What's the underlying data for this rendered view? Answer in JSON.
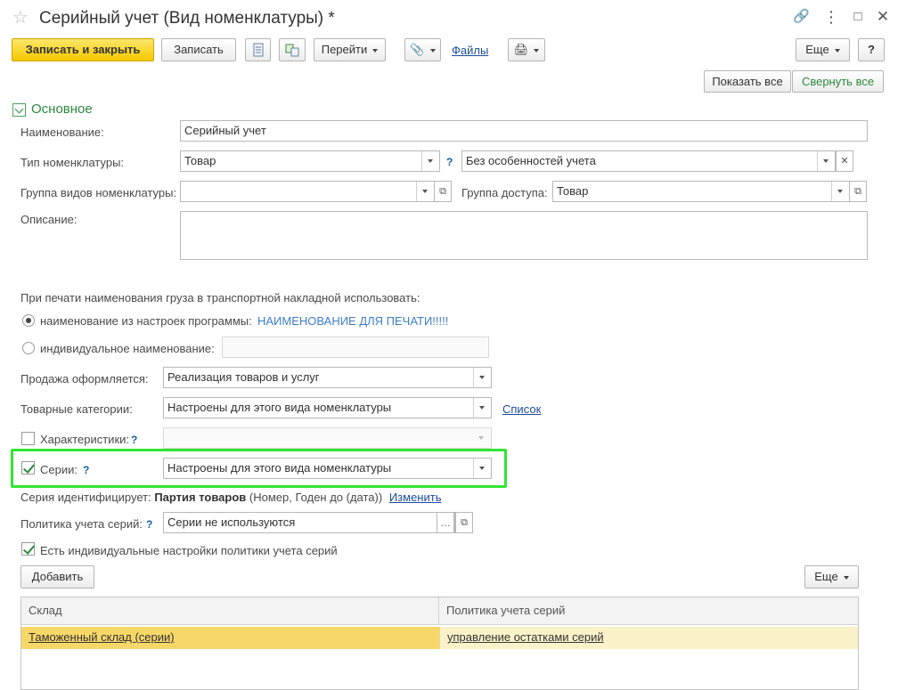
{
  "window": {
    "title": "Серийный учет (Вид номенклатуры) *"
  },
  "toolbar": {
    "save_close": "Записать и закрыть",
    "save": "Записать",
    "goto": "Перейти",
    "files": "Файлы",
    "more": "Еще",
    "help": "?"
  },
  "view_buttons": {
    "show_all": "Показать все",
    "collapse_all": "Свернуть все"
  },
  "section": {
    "title": "Основное"
  },
  "form": {
    "name_label": "Наименование:",
    "name_value": "Серийный учет",
    "type_label": "Тип номенклатуры:",
    "type_value": "Товар",
    "type_help": "?",
    "type_feature_value": "Без особенностей учета",
    "group_label": "Группа видов номенклатуры:",
    "group_value": "",
    "access_label": "Группа доступа:",
    "access_value": "Товар",
    "description_label": "Описание:",
    "description_value": ""
  },
  "print_name": {
    "caption": "При печати наименования груза в транспортной накладной использовать:",
    "option1": "наименование из настроек программы:",
    "option1_value": "НАИМЕНОВАНИЕ ДЛЯ ПЕЧАТИ!!!!!",
    "option2": "индивидуальное наименование:",
    "option2_value": "",
    "selected": "option1"
  },
  "sale": {
    "label": "Продажа оформляется:",
    "value": "Реализация товаров и услуг"
  },
  "categories": {
    "label": "Товарные категории:",
    "value": "Настроены для этого вида номенклатуры",
    "link": "Список"
  },
  "characteristics": {
    "label": "Характеристики:",
    "help": "?",
    "checked": false,
    "value": ""
  },
  "series": {
    "label": "Серии:",
    "help": "?",
    "checked": true,
    "value": "Настроены для этого вида номенклатуры",
    "identifies_prefix": "Серия идентифицирует:",
    "identifies_bold": "Партия товаров",
    "identifies_suffix": "(Номер, Годен до (дата))",
    "change_link": "Изменить",
    "policy_label": "Политика учета серий:",
    "policy_help": "?",
    "policy_value": "Серии не используются",
    "individual_label": "Есть индивидуальные настройки политики учета серий",
    "individual_checked": true
  },
  "table_toolbar": {
    "add": "Добавить",
    "more": "Еще"
  },
  "table": {
    "columns": [
      "Склад",
      "Политика учета серий"
    ],
    "rows": [
      [
        "Таможенный склад (серии)",
        "управление остатками серий"
      ]
    ]
  },
  "colors": {
    "highlight_frame": "#33e433",
    "primary_button": "#f5c800",
    "section_green": "#2b8a3e",
    "link_blue": "#1a4c9c",
    "selected_row": "#fbf2c9"
  }
}
